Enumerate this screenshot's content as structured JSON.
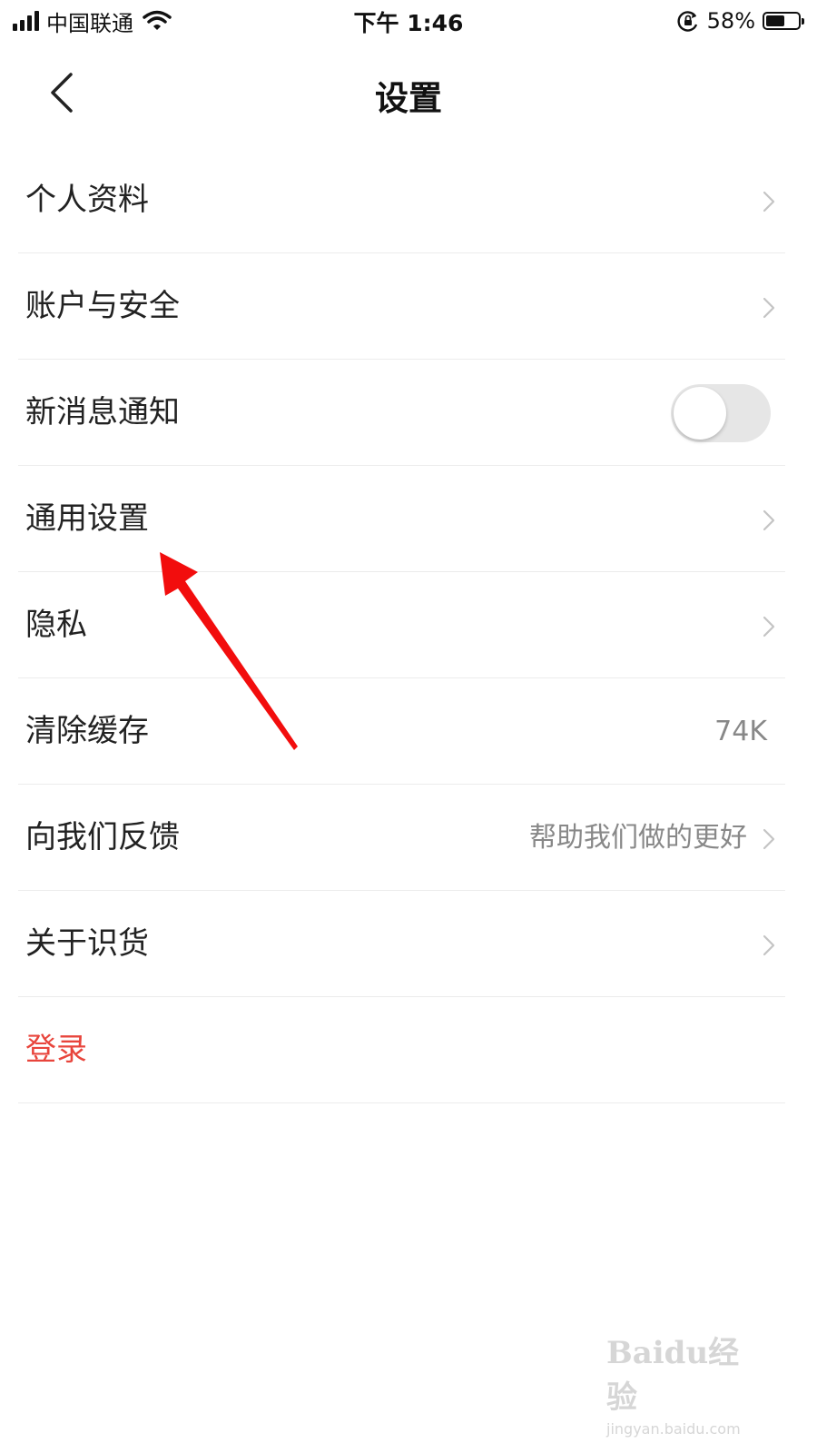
{
  "status_bar": {
    "carrier": "中国联通",
    "time": "下午 1:46",
    "battery_percent": "58%",
    "battery_level": 0.58,
    "signal_icon": "signal-bars-icon",
    "wifi_icon": "wifi-icon",
    "rotation_lock_icon": "rotation-lock-icon"
  },
  "nav": {
    "title": "设置",
    "back_icon": "chevron-left-icon"
  },
  "settings": {
    "items": [
      {
        "label": "个人资料"
      },
      {
        "label": "账户与安全"
      },
      {
        "label": "新消息通知",
        "toggle_on": false
      },
      {
        "label": "通用设置"
      },
      {
        "label": "隐私"
      },
      {
        "label": "清除缓存",
        "value": "74K"
      },
      {
        "label": "向我们反馈",
        "value": "帮助我们做的更好"
      },
      {
        "label": "关于识货"
      },
      {
        "label": "登录"
      }
    ]
  },
  "watermark": {
    "logo": "Baidu经验",
    "url": "jingyan.baidu.com"
  },
  "colors": {
    "login_text": "#e8453c",
    "annotation_arrow": "#f20d0d",
    "divider": "#ececec",
    "secondary_text": "#888888"
  }
}
